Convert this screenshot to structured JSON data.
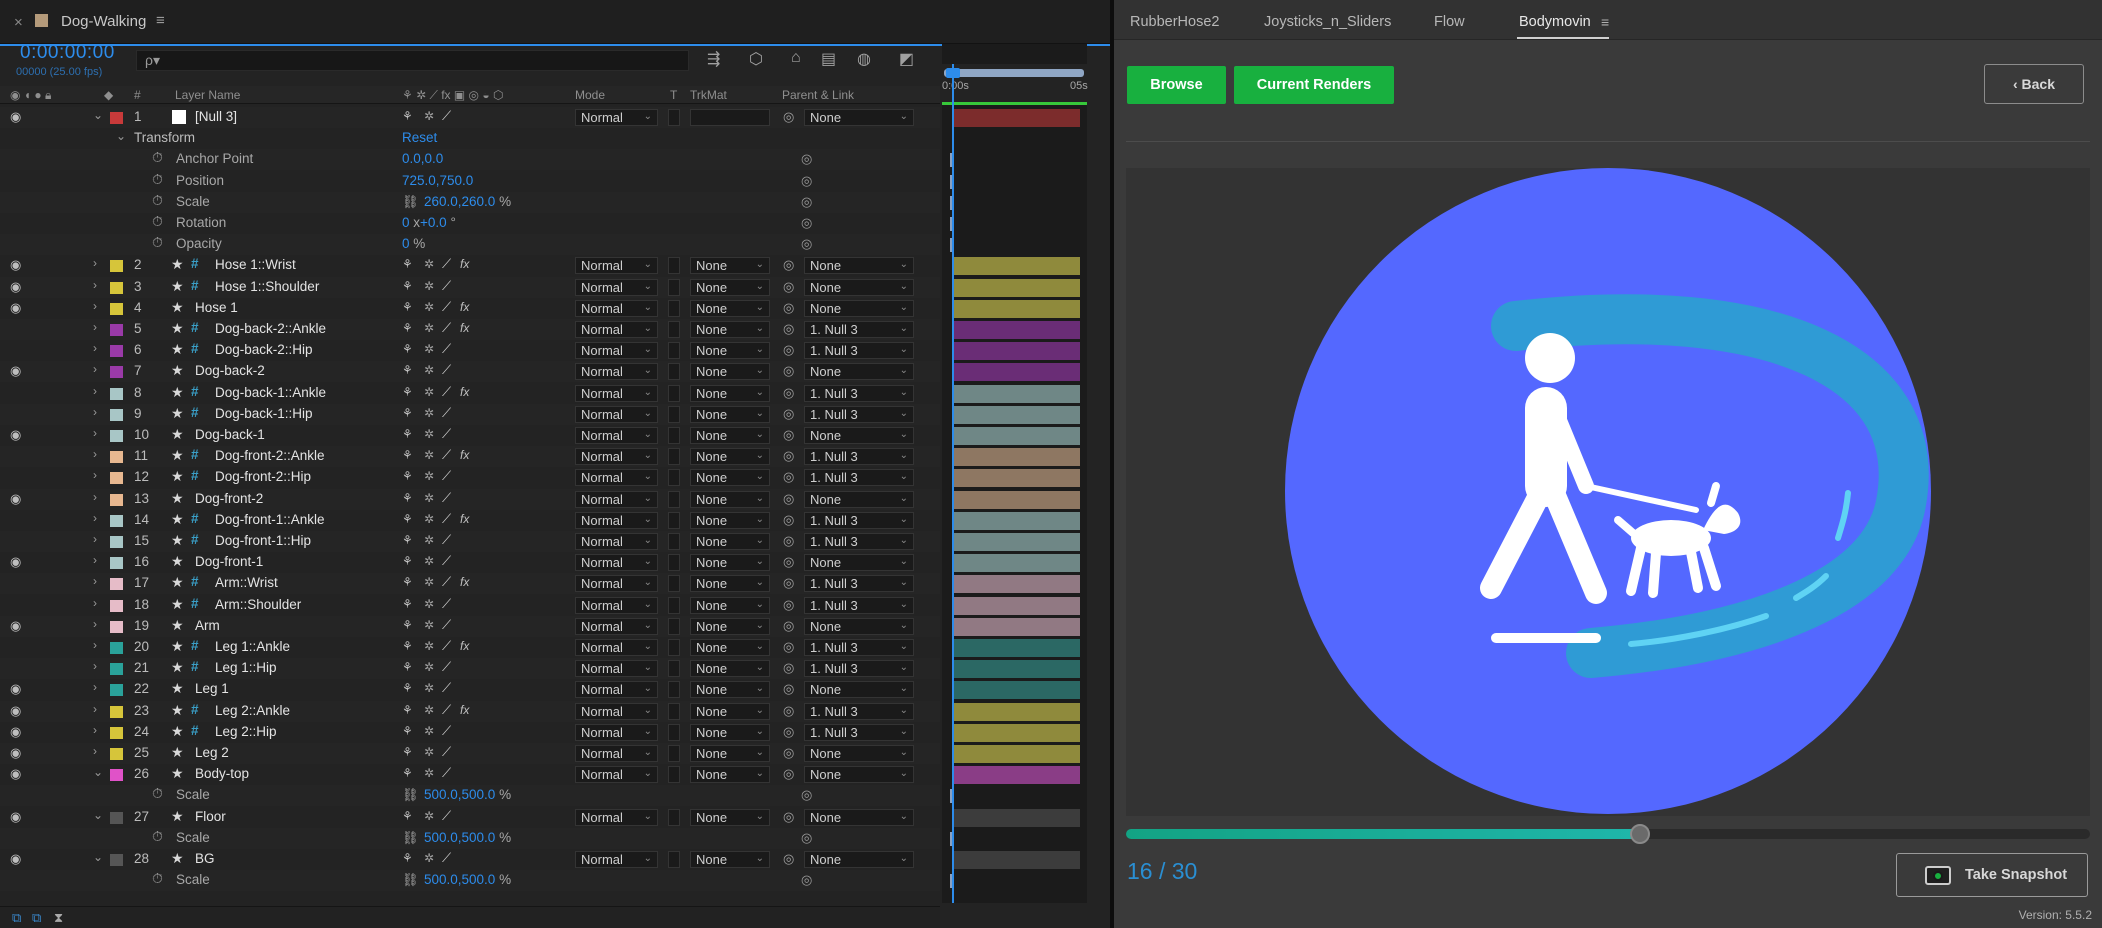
{
  "comp": {
    "close": "×",
    "name": "Dog-Walking",
    "menu": "≡",
    "timecode": "0:00:00:00",
    "fps": "00000 (25.00 fps)",
    "search_icon": "ρ▾"
  },
  "headers": {
    "num": "#",
    "layer_name": "Layer Name",
    "mode": "Mode",
    "t": "T",
    "trkmat": "TrkMat",
    "parent": "Parent & Link"
  },
  "timeline": {
    "t0": "0:00s",
    "t5": "05s"
  },
  "rows": [
    {
      "type": "layer",
      "num": "1",
      "name": "[Null 3]",
      "label": "#c83a3a",
      "eye": true,
      "expanded": true,
      "solid": true,
      "mode": "Normal",
      "trkmat": "",
      "parent": "None",
      "bar": "#7c2c2c"
    },
    {
      "type": "group",
      "name": "Transform",
      "value": "Reset"
    },
    {
      "type": "prop",
      "name": "Anchor Point",
      "value": "0.0,0.0",
      "unit": "",
      "expr": true
    },
    {
      "type": "prop",
      "name": "Position",
      "value": "725.0,750.0",
      "unit": "",
      "expr": true
    },
    {
      "type": "prop",
      "name": "Scale",
      "value": "260.0,260.0",
      "unit": "%",
      "link": true,
      "expr": true
    },
    {
      "type": "prop",
      "name": "Rotation",
      "value": "0",
      "unit": "x",
      "value2": "+0.0",
      "unit2": "°",
      "expr": true
    },
    {
      "type": "prop",
      "name": "Opacity",
      "value": "0",
      "unit": "%",
      "expr": true
    },
    {
      "type": "layer",
      "num": "2",
      "name": "Hose 1::Wrist",
      "label": "#d6c53a",
      "eye": true,
      "hash": true,
      "fx": true,
      "mode": "Normal",
      "trkmat": "None",
      "parent": "None",
      "bar": "#8f8a3c"
    },
    {
      "type": "layer",
      "num": "3",
      "name": "Hose 1::Shoulder",
      "label": "#d6c53a",
      "eye": true,
      "hash": true,
      "mode": "Normal",
      "trkmat": "None",
      "parent": "None",
      "bar": "#8f8a3c"
    },
    {
      "type": "layer",
      "num": "4",
      "name": "Hose 1",
      "label": "#d6c53a",
      "eye": true,
      "fx": true,
      "mode": "Normal",
      "trkmat": "None",
      "parent": "None",
      "bar": "#8f8a3c"
    },
    {
      "type": "layer",
      "num": "5",
      "name": "Dog-back-2::Ankle",
      "label": "#9a3aa8",
      "hash": true,
      "fx": true,
      "mode": "Normal",
      "trkmat": "None",
      "parent": "1. Null 3",
      "bar": "#6a2d76"
    },
    {
      "type": "layer",
      "num": "6",
      "name": "Dog-back-2::Hip",
      "label": "#9a3aa8",
      "hash": true,
      "mode": "Normal",
      "trkmat": "None",
      "parent": "1. Null 3",
      "bar": "#6a2d76"
    },
    {
      "type": "layer",
      "num": "7",
      "name": "Dog-back-2",
      "label": "#9a3aa8",
      "eye": true,
      "mode": "Normal",
      "trkmat": "None",
      "parent": "None",
      "bar": "#6a2d76"
    },
    {
      "type": "layer",
      "num": "8",
      "name": "Dog-back-1::Ankle",
      "label": "#a8c6c6",
      "hash": true,
      "fx": true,
      "mode": "Normal",
      "trkmat": "None",
      "parent": "1. Null 3",
      "bar": "#6f8786"
    },
    {
      "type": "layer",
      "num": "9",
      "name": "Dog-back-1::Hip",
      "label": "#a8c6c6",
      "hash": true,
      "mode": "Normal",
      "trkmat": "None",
      "parent": "1. Null 3",
      "bar": "#6f8786"
    },
    {
      "type": "layer",
      "num": "10",
      "name": "Dog-back-1",
      "label": "#a8c6c6",
      "eye": true,
      "mode": "Normal",
      "trkmat": "None",
      "parent": "None",
      "bar": "#6f8786"
    },
    {
      "type": "layer",
      "num": "11",
      "name": "Dog-front-2::Ankle",
      "label": "#e8b890",
      "hash": true,
      "fx": true,
      "mode": "Normal",
      "trkmat": "None",
      "parent": "1. Null 3",
      "bar": "#8e7762"
    },
    {
      "type": "layer",
      "num": "12",
      "name": "Dog-front-2::Hip",
      "label": "#e8b890",
      "hash": true,
      "mode": "Normal",
      "trkmat": "None",
      "parent": "1. Null 3",
      "bar": "#8e7762"
    },
    {
      "type": "layer",
      "num": "13",
      "name": "Dog-front-2",
      "label": "#e8b890",
      "eye": true,
      "mode": "Normal",
      "trkmat": "None",
      "parent": "None",
      "bar": "#8e7762"
    },
    {
      "type": "layer",
      "num": "14",
      "name": "Dog-front-1::Ankle",
      "label": "#a8c6c6",
      "hash": true,
      "fx": true,
      "mode": "Normal",
      "trkmat": "None",
      "parent": "1. Null 3",
      "bar": "#6f8786"
    },
    {
      "type": "layer",
      "num": "15",
      "name": "Dog-front-1::Hip",
      "label": "#a8c6c6",
      "hash": true,
      "mode": "Normal",
      "trkmat": "None",
      "parent": "1. Null 3",
      "bar": "#6f8786"
    },
    {
      "type": "layer",
      "num": "16",
      "name": "Dog-front-1",
      "label": "#a8c6c6",
      "eye": true,
      "mode": "Normal",
      "trkmat": "None",
      "parent": "None",
      "bar": "#6f8786"
    },
    {
      "type": "layer",
      "num": "17",
      "name": "Arm::Wrist",
      "label": "#e6bcc8",
      "hash": true,
      "fx": true,
      "mode": "Normal",
      "trkmat": "None",
      "parent": "1. Null 3",
      "bar": "#917983"
    },
    {
      "type": "layer",
      "num": "18",
      "name": "Arm::Shoulder",
      "label": "#e6bcc8",
      "hash": true,
      "mode": "Normal",
      "trkmat": "None",
      "parent": "1. Null 3",
      "bar": "#917983"
    },
    {
      "type": "layer",
      "num": "19",
      "name": "Arm",
      "label": "#e6bcc8",
      "eye": true,
      "mode": "Normal",
      "trkmat": "None",
      "parent": "None",
      "bar": "#917983"
    },
    {
      "type": "layer",
      "num": "20",
      "name": "Leg 1::Ankle",
      "label": "#2aa29a",
      "hash": true,
      "fx": true,
      "mode": "Normal",
      "trkmat": "None",
      "parent": "1. Null 3",
      "bar": "#2b6864"
    },
    {
      "type": "layer",
      "num": "21",
      "name": "Leg 1::Hip",
      "label": "#2aa29a",
      "hash": true,
      "mode": "Normal",
      "trkmat": "None",
      "parent": "1. Null 3",
      "bar": "#2b6864"
    },
    {
      "type": "layer",
      "num": "22",
      "name": "Leg 1",
      "label": "#2aa29a",
      "eye": true,
      "mode": "Normal",
      "trkmat": "None",
      "parent": "None",
      "bar": "#2b6864"
    },
    {
      "type": "layer",
      "num": "23",
      "name": "Leg 2::Ankle",
      "label": "#d6c53a",
      "eye": true,
      "hash": true,
      "fx": true,
      "mode": "Normal",
      "trkmat": "None",
      "parent": "1. Null 3",
      "bar": "#8f8a3c"
    },
    {
      "type": "layer",
      "num": "24",
      "name": "Leg 2::Hip",
      "label": "#d6c53a",
      "eye": true,
      "hash": true,
      "mode": "Normal",
      "trkmat": "None",
      "parent": "1. Null 3",
      "bar": "#8f8a3c"
    },
    {
      "type": "layer",
      "num": "25",
      "name": "Leg 2",
      "label": "#d6c53a",
      "eye": true,
      "mode": "Normal",
      "trkmat": "None",
      "parent": "None",
      "bar": "#8f8a3c"
    },
    {
      "type": "layer",
      "num": "26",
      "name": "Body-top",
      "label": "#e052c8",
      "eye": true,
      "expanded": true,
      "mode": "Normal",
      "trkmat": "None",
      "parent": "None",
      "bar": "#8a3d86"
    },
    {
      "type": "prop",
      "name": "Scale",
      "value": "500.0,500.0",
      "unit": "%",
      "link": true,
      "expr": true
    },
    {
      "type": "layer",
      "num": "27",
      "name": "Floor",
      "label": "#555555",
      "eye": true,
      "expanded": true,
      "mode": "Normal",
      "trkmat": "None",
      "parent": "None",
      "bar": "#3c3c3c"
    },
    {
      "type": "prop",
      "name": "Scale",
      "value": "500.0,500.0",
      "unit": "%",
      "link": true,
      "expr": true
    },
    {
      "type": "layer",
      "num": "28",
      "name": "BG",
      "label": "#555555",
      "eye": true,
      "expanded": true,
      "mode": "Normal",
      "trkmat": "None",
      "parent": "None",
      "bar": "#3c3c3c"
    },
    {
      "type": "prop",
      "name": "Scale",
      "value": "500.0,500.0",
      "unit": "%",
      "link": true,
      "expr": true
    }
  ],
  "panel": {
    "tabs": [
      "RubberHose2",
      "Joysticks_n_Sliders",
      "Flow",
      "Bodymovin"
    ],
    "active_tab": "Bodymovin",
    "menu": "≡",
    "browse": "Browse",
    "current_renders": "Current Renders",
    "back": "‹ Back",
    "frame": "16 / 30",
    "progress": 0.533,
    "snapshot": "Take Snapshot",
    "version": "Version: 5.5.2"
  },
  "colors": {
    "accent": "#2d8ceb",
    "green": "#18b03f",
    "circle": "#5468ff",
    "hose": "#2f9bd5"
  }
}
